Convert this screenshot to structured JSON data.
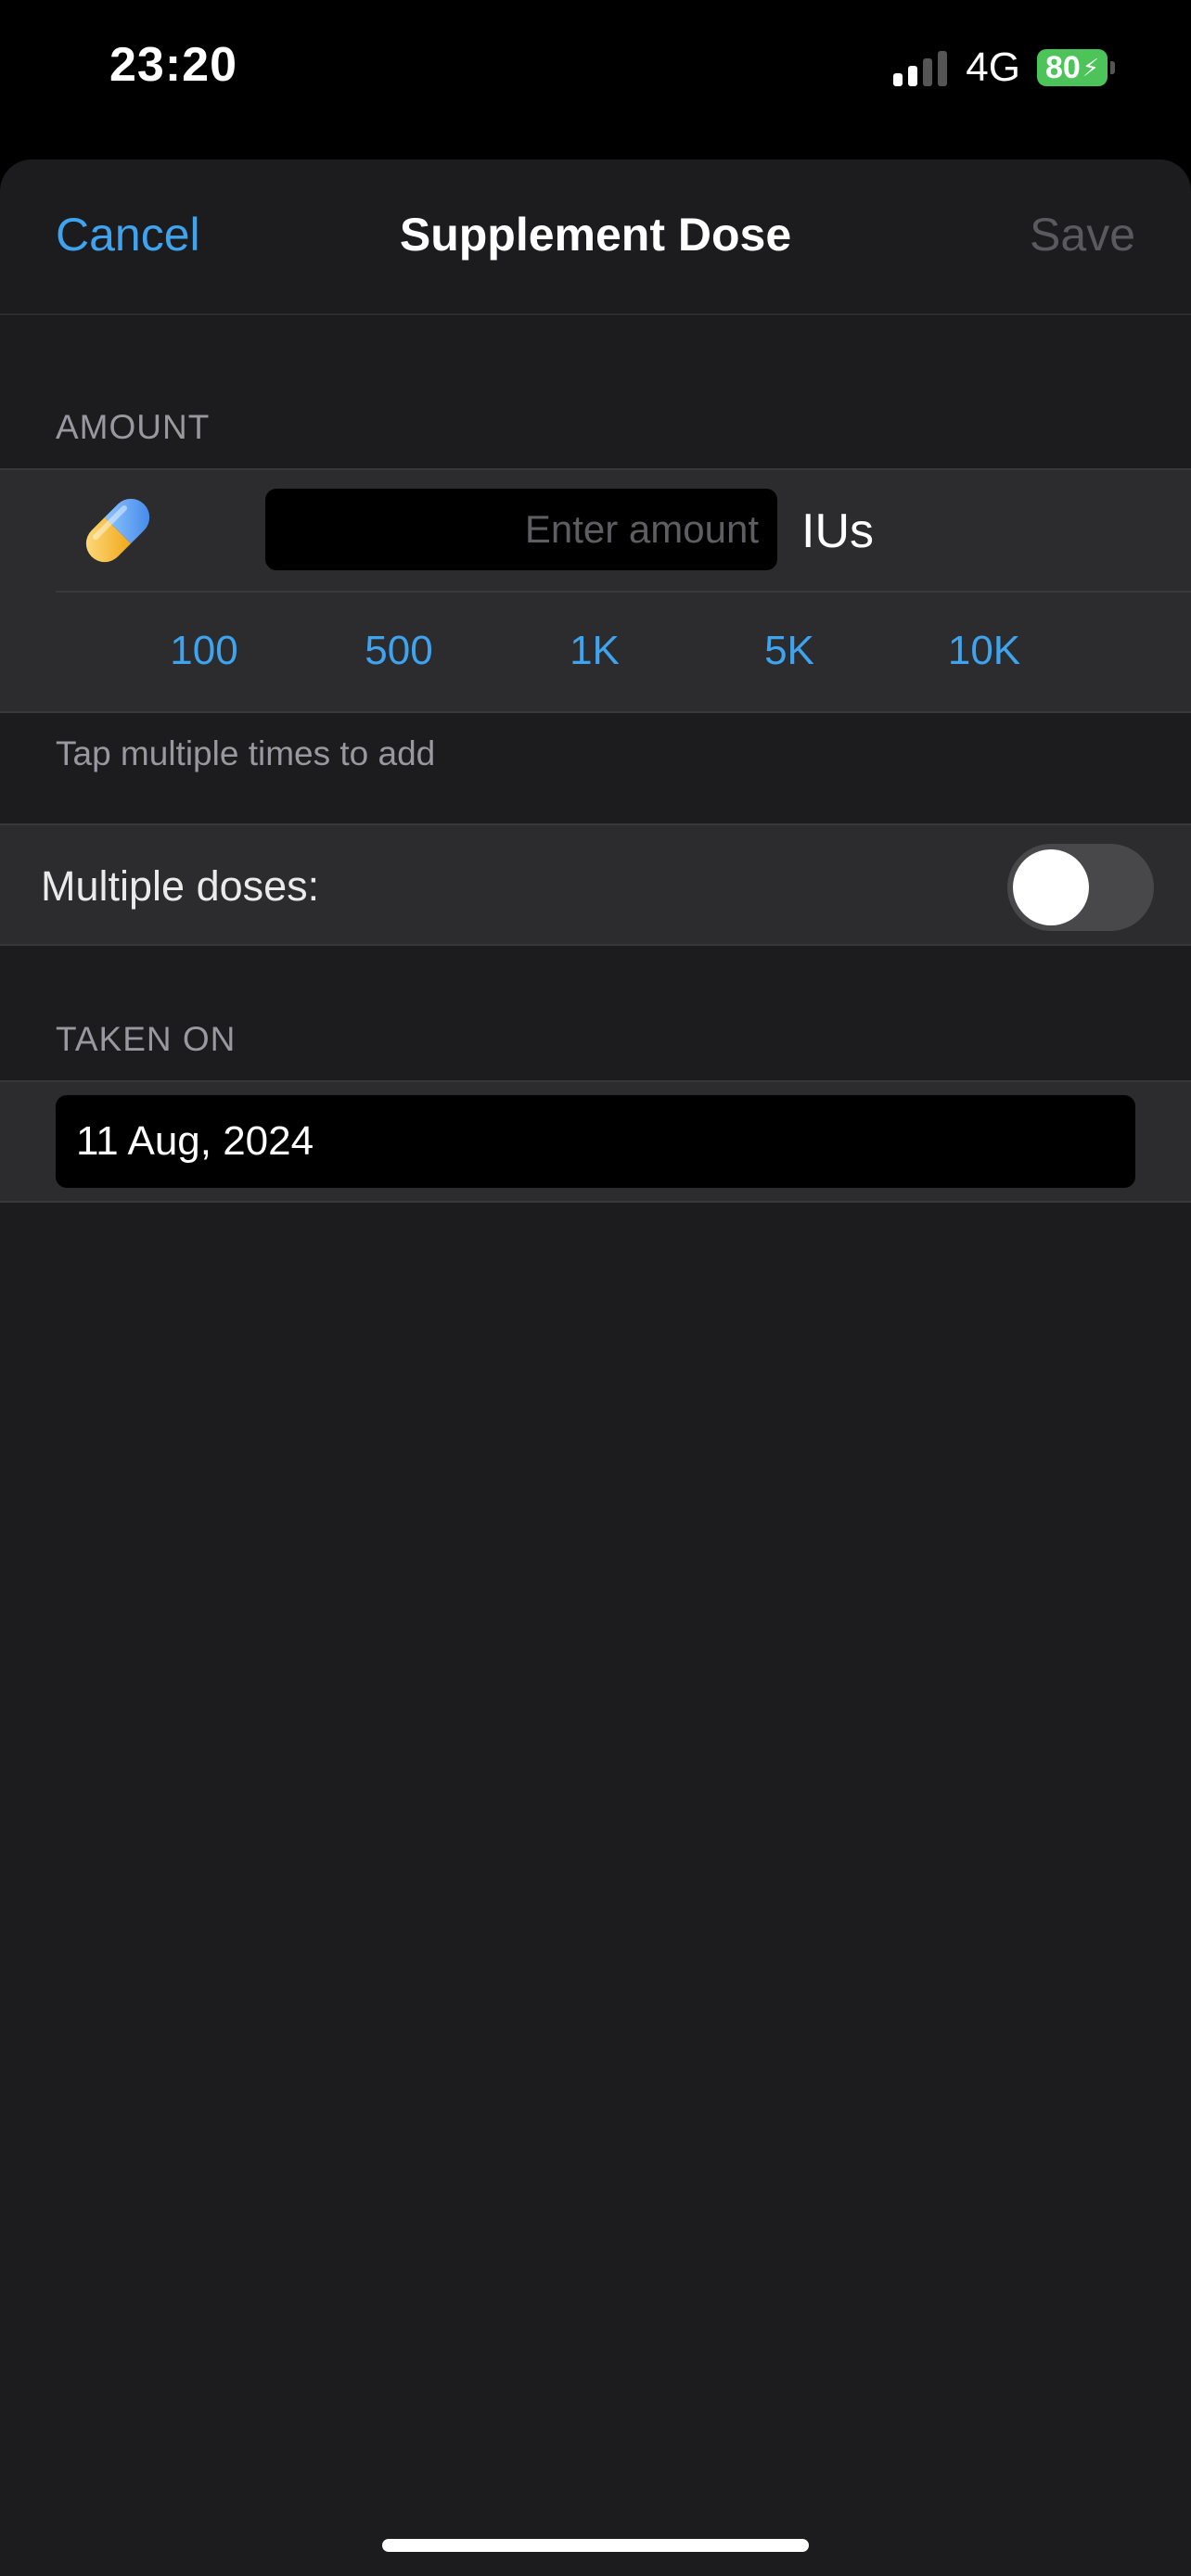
{
  "status_bar": {
    "time": "23:20",
    "network": "4G",
    "battery": "80",
    "icons": [
      "signal-icon",
      "battery-icon",
      "charging-bolt-icon"
    ]
  },
  "nav": {
    "cancel_label": "Cancel",
    "title": "Supplement Dose",
    "save_label": "Save"
  },
  "amount": {
    "header": "AMOUNT",
    "icon": "pill-icon",
    "placeholder": "Enter amount",
    "value": "",
    "unit": "IUs",
    "presets": [
      "100",
      "500",
      "1K",
      "5K",
      "10K"
    ],
    "footer": "Tap multiple times to add"
  },
  "multiple_doses": {
    "label": "Multiple doses:",
    "enabled": false
  },
  "taken_on": {
    "header": "TAKEN ON",
    "date": "11 Aug, 2024"
  },
  "colors": {
    "accent": "#3ea4f0",
    "background": "#1c1c1e",
    "group": "#2c2c2e",
    "disabled": "#5a5a5e"
  }
}
